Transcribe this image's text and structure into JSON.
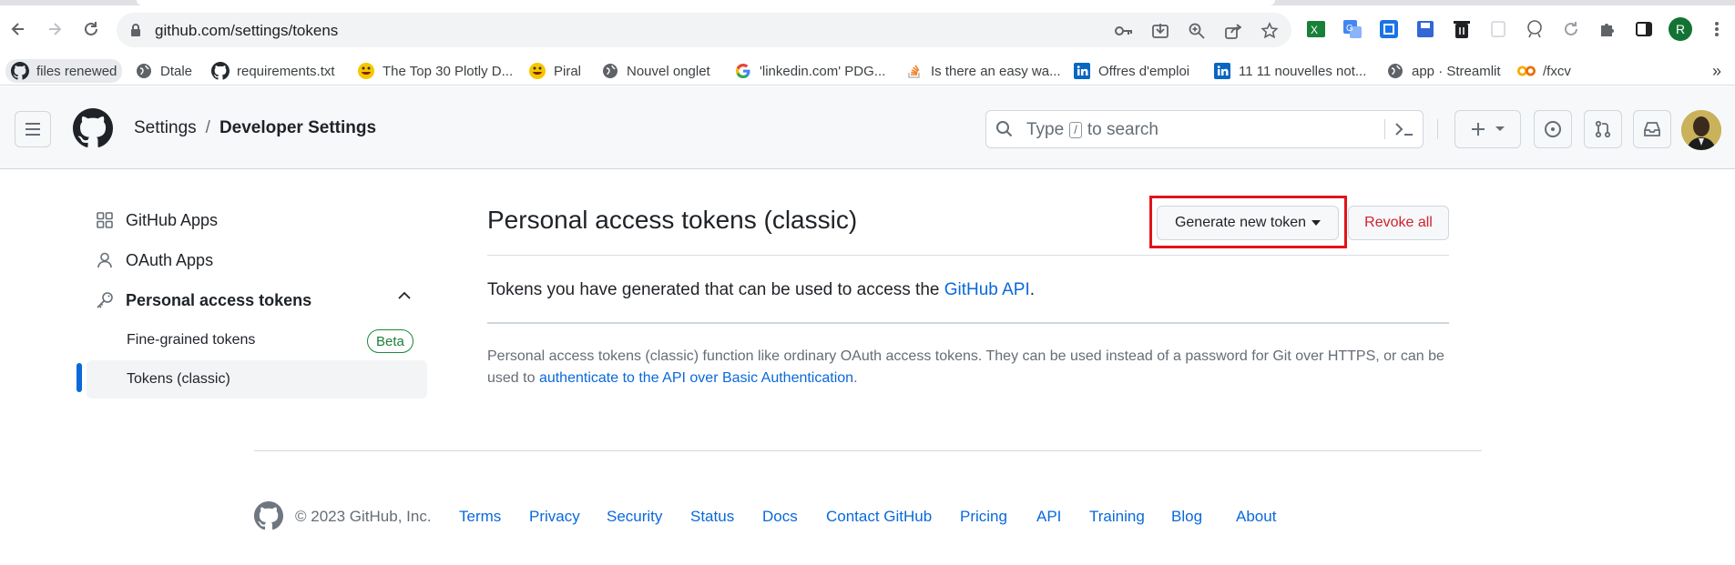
{
  "browser": {
    "url": "github.com/settings/tokens",
    "profile_initial": "R",
    "bookmarks": [
      {
        "label": "files renewed",
        "icon": "github-icon"
      },
      {
        "label": "Dtale",
        "icon": "globe-icon"
      },
      {
        "label": "requirements.txt",
        "icon": "github-icon"
      },
      {
        "label": "The Top 30 Plotly D...",
        "icon": "emoji-icon"
      },
      {
        "label": "Piral",
        "icon": "emoji-icon"
      },
      {
        "label": "Nouvel onglet",
        "icon": "globe-icon"
      },
      {
        "label": "'linkedin.com' PDG...",
        "icon": "google-icon"
      },
      {
        "label": "Is there an easy wa...",
        "icon": "stackoverflow-icon"
      },
      {
        "label": "Offres d'emploi",
        "icon": "linkedin-icon"
      },
      {
        "label": "11 11 nouvelles not...",
        "icon": "linkedin-icon"
      },
      {
        "label": "app · Streamlit",
        "icon": "globe-icon"
      },
      {
        "label": "/fxcv",
        "icon": "colab-icon"
      }
    ],
    "more_bookmarks": "»"
  },
  "header": {
    "breadcrumb_settings": "Settings",
    "breadcrumb_sep": "/",
    "breadcrumb_dev": "Developer Settings",
    "search_prefix": "Type",
    "search_key": "/",
    "search_suffix": "to search"
  },
  "sidebar": {
    "github_apps": "GitHub Apps",
    "oauth_apps": "OAuth Apps",
    "personal_access_tokens": "Personal access tokens",
    "fine_grained": "Fine-grained tokens",
    "beta": "Beta",
    "tokens_classic": "Tokens (classic)"
  },
  "main": {
    "title": "Personal access tokens (classic)",
    "generate_button": "Generate new token",
    "revoke_button": "Revoke all",
    "tokens_text": "Tokens you have generated that can be used to access the",
    "tokens_link": "GitHub API",
    "tokens_period": ".",
    "desc_text": "Personal access tokens (classic) function like ordinary OAuth access tokens. They can be used instead of a password for Git over HTTPS, or can be used to",
    "desc_link": "authenticate to the API over Basic Authentication",
    "desc_period": "."
  },
  "footer": {
    "copyright": "© 2023 GitHub, Inc.",
    "links": [
      "Terms",
      "Privacy",
      "Security",
      "Status",
      "Docs",
      "Contact GitHub",
      "Pricing",
      "API",
      "Training",
      "Blog",
      "About"
    ]
  },
  "colors": {
    "link": "#0969da",
    "danger": "#cf222e",
    "highlight": "#e0141c",
    "beta": "#1a7f37"
  }
}
